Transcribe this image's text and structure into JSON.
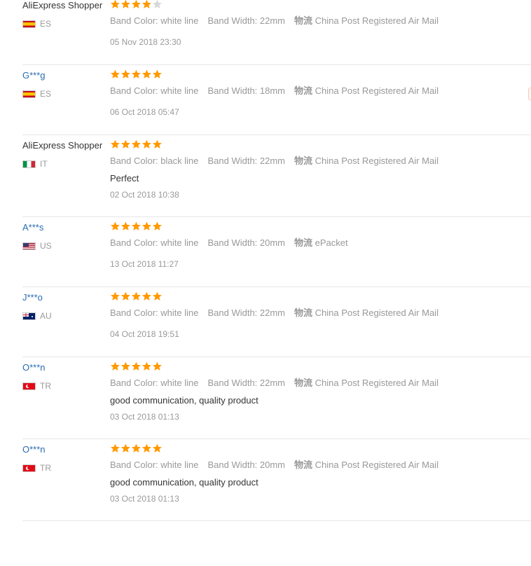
{
  "colors": {
    "link": "#2b6cb0",
    "star_filled": "#ff9900",
    "star_empty": "#d8d8d8",
    "muted_text": "#999999",
    "body_text": "#333333",
    "divider": "#e6e6e6"
  },
  "shipping_label": "物流",
  "reviews": [
    {
      "user": "AliExpress Shopper",
      "user_is_link": false,
      "country_code": "ES",
      "flag_icon": "spain-flag-icon",
      "stars": 4,
      "band_color": "Band Color: white line",
      "band_width": "Band Width: 22mm",
      "shipping": "China Post Registered Air Mail",
      "feedback": "",
      "date": "05 Nov 2018 23:30"
    },
    {
      "user": "G***g",
      "user_is_link": true,
      "country_code": "ES",
      "flag_icon": "spain-flag-icon",
      "stars": 5,
      "band_color": "Band Color: white line",
      "band_width": "Band Width: 18mm",
      "shipping": "China Post Registered Air Mail",
      "feedback": "",
      "date": "06 Oct 2018 05:47"
    },
    {
      "user": "AliExpress Shopper",
      "user_is_link": false,
      "country_code": "IT",
      "flag_icon": "italy-flag-icon",
      "stars": 5,
      "band_color": "Band Color: black line",
      "band_width": "Band Width: 22mm",
      "shipping": "China Post Registered Air Mail",
      "feedback": "Perfect",
      "date": "02 Oct 2018 10:38"
    },
    {
      "user": "A***s",
      "user_is_link": true,
      "country_code": "US",
      "flag_icon": "usa-flag-icon",
      "stars": 5,
      "band_color": "Band Color: white line",
      "band_width": "Band Width: 20mm",
      "shipping": "ePacket",
      "feedback": "",
      "date": "13 Oct 2018 11:27"
    },
    {
      "user": "J***o",
      "user_is_link": true,
      "country_code": "AU",
      "flag_icon": "australia-flag-icon",
      "stars": 5,
      "band_color": "Band Color: white line",
      "band_width": "Band Width: 22mm",
      "shipping": "China Post Registered Air Mail",
      "feedback": "",
      "date": "04 Oct 2018 19:51"
    },
    {
      "user": "O***n",
      "user_is_link": true,
      "country_code": "TR",
      "flag_icon": "turkey-flag-icon",
      "stars": 5,
      "band_color": "Band Color: white line",
      "band_width": "Band Width: 22mm",
      "shipping": "China Post Registered Air Mail",
      "feedback": "good communication, quality product",
      "date": "03 Oct 2018 01:13"
    },
    {
      "user": "O***n",
      "user_is_link": true,
      "country_code": "TR",
      "flag_icon": "turkey-flag-icon",
      "stars": 5,
      "band_color": "Band Color: white line",
      "band_width": "Band Width: 20mm",
      "shipping": "China Post Registered Air Mail",
      "feedback": "good communication, quality product",
      "date": "03 Oct 2018 01:13"
    }
  ]
}
